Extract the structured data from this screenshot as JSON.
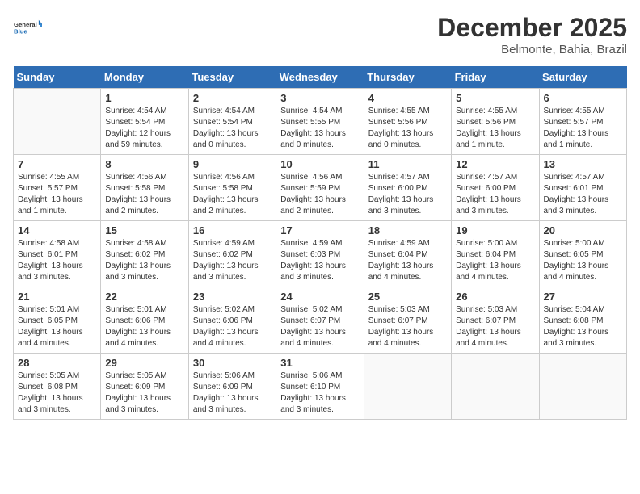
{
  "logo": {
    "line1": "General",
    "line2": "Blue"
  },
  "title": "December 2025",
  "subtitle": "Belmonte, Bahia, Brazil",
  "days_header": [
    "Sunday",
    "Monday",
    "Tuesday",
    "Wednesday",
    "Thursday",
    "Friday",
    "Saturday"
  ],
  "weeks": [
    [
      {
        "day": "",
        "info": ""
      },
      {
        "day": "1",
        "info": "Sunrise: 4:54 AM\nSunset: 5:54 PM\nDaylight: 12 hours\nand 59 minutes."
      },
      {
        "day": "2",
        "info": "Sunrise: 4:54 AM\nSunset: 5:54 PM\nDaylight: 13 hours\nand 0 minutes."
      },
      {
        "day": "3",
        "info": "Sunrise: 4:54 AM\nSunset: 5:55 PM\nDaylight: 13 hours\nand 0 minutes."
      },
      {
        "day": "4",
        "info": "Sunrise: 4:55 AM\nSunset: 5:56 PM\nDaylight: 13 hours\nand 0 minutes."
      },
      {
        "day": "5",
        "info": "Sunrise: 4:55 AM\nSunset: 5:56 PM\nDaylight: 13 hours\nand 1 minute."
      },
      {
        "day": "6",
        "info": "Sunrise: 4:55 AM\nSunset: 5:57 PM\nDaylight: 13 hours\nand 1 minute."
      }
    ],
    [
      {
        "day": "7",
        "info": "Sunrise: 4:55 AM\nSunset: 5:57 PM\nDaylight: 13 hours\nand 1 minute."
      },
      {
        "day": "8",
        "info": "Sunrise: 4:56 AM\nSunset: 5:58 PM\nDaylight: 13 hours\nand 2 minutes."
      },
      {
        "day": "9",
        "info": "Sunrise: 4:56 AM\nSunset: 5:58 PM\nDaylight: 13 hours\nand 2 minutes."
      },
      {
        "day": "10",
        "info": "Sunrise: 4:56 AM\nSunset: 5:59 PM\nDaylight: 13 hours\nand 2 minutes."
      },
      {
        "day": "11",
        "info": "Sunrise: 4:57 AM\nSunset: 6:00 PM\nDaylight: 13 hours\nand 3 minutes."
      },
      {
        "day": "12",
        "info": "Sunrise: 4:57 AM\nSunset: 6:00 PM\nDaylight: 13 hours\nand 3 minutes."
      },
      {
        "day": "13",
        "info": "Sunrise: 4:57 AM\nSunset: 6:01 PM\nDaylight: 13 hours\nand 3 minutes."
      }
    ],
    [
      {
        "day": "14",
        "info": "Sunrise: 4:58 AM\nSunset: 6:01 PM\nDaylight: 13 hours\nand 3 minutes."
      },
      {
        "day": "15",
        "info": "Sunrise: 4:58 AM\nSunset: 6:02 PM\nDaylight: 13 hours\nand 3 minutes."
      },
      {
        "day": "16",
        "info": "Sunrise: 4:59 AM\nSunset: 6:02 PM\nDaylight: 13 hours\nand 3 minutes."
      },
      {
        "day": "17",
        "info": "Sunrise: 4:59 AM\nSunset: 6:03 PM\nDaylight: 13 hours\nand 3 minutes."
      },
      {
        "day": "18",
        "info": "Sunrise: 4:59 AM\nSunset: 6:04 PM\nDaylight: 13 hours\nand 4 minutes."
      },
      {
        "day": "19",
        "info": "Sunrise: 5:00 AM\nSunset: 6:04 PM\nDaylight: 13 hours\nand 4 minutes."
      },
      {
        "day": "20",
        "info": "Sunrise: 5:00 AM\nSunset: 6:05 PM\nDaylight: 13 hours\nand 4 minutes."
      }
    ],
    [
      {
        "day": "21",
        "info": "Sunrise: 5:01 AM\nSunset: 6:05 PM\nDaylight: 13 hours\nand 4 minutes."
      },
      {
        "day": "22",
        "info": "Sunrise: 5:01 AM\nSunset: 6:06 PM\nDaylight: 13 hours\nand 4 minutes."
      },
      {
        "day": "23",
        "info": "Sunrise: 5:02 AM\nSunset: 6:06 PM\nDaylight: 13 hours\nand 4 minutes."
      },
      {
        "day": "24",
        "info": "Sunrise: 5:02 AM\nSunset: 6:07 PM\nDaylight: 13 hours\nand 4 minutes."
      },
      {
        "day": "25",
        "info": "Sunrise: 5:03 AM\nSunset: 6:07 PM\nDaylight: 13 hours\nand 4 minutes."
      },
      {
        "day": "26",
        "info": "Sunrise: 5:03 AM\nSunset: 6:07 PM\nDaylight: 13 hours\nand 4 minutes."
      },
      {
        "day": "27",
        "info": "Sunrise: 5:04 AM\nSunset: 6:08 PM\nDaylight: 13 hours\nand 3 minutes."
      }
    ],
    [
      {
        "day": "28",
        "info": "Sunrise: 5:05 AM\nSunset: 6:08 PM\nDaylight: 13 hours\nand 3 minutes."
      },
      {
        "day": "29",
        "info": "Sunrise: 5:05 AM\nSunset: 6:09 PM\nDaylight: 13 hours\nand 3 minutes."
      },
      {
        "day": "30",
        "info": "Sunrise: 5:06 AM\nSunset: 6:09 PM\nDaylight: 13 hours\nand 3 minutes."
      },
      {
        "day": "31",
        "info": "Sunrise: 5:06 AM\nSunset: 6:10 PM\nDaylight: 13 hours\nand 3 minutes."
      },
      {
        "day": "",
        "info": ""
      },
      {
        "day": "",
        "info": ""
      },
      {
        "day": "",
        "info": ""
      }
    ]
  ]
}
